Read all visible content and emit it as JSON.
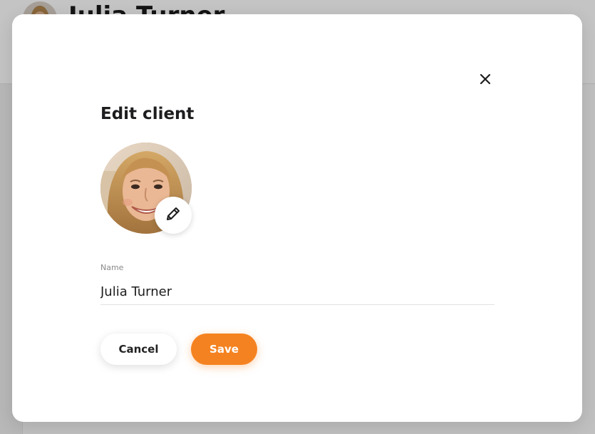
{
  "background": {
    "client_name": "Julia Turner"
  },
  "modal": {
    "title": "Edit client",
    "close_icon": "close-icon",
    "edit_photo_icon": "pencil-icon",
    "name_field": {
      "label": "Name",
      "value": "Julia Turner"
    },
    "buttons": {
      "cancel_label": "Cancel",
      "save_label": "Save"
    }
  },
  "colors": {
    "accent": "#f58220",
    "text_primary": "#1d1d1f",
    "label": "#8a8a8a",
    "divider": "#e2e2e2"
  }
}
